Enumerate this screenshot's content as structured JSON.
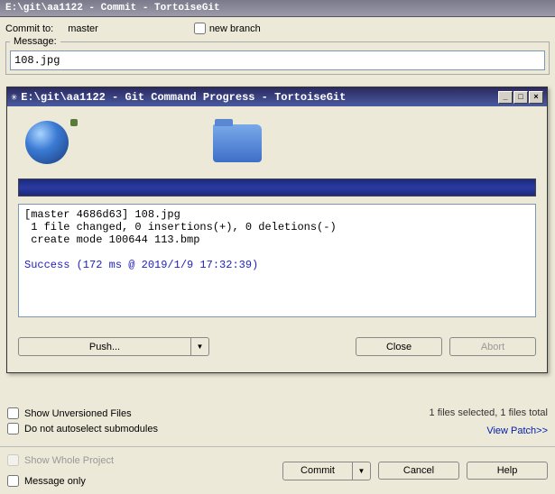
{
  "outer": {
    "title": "E:\\git\\aa1122 - Commit - TortoiseGit",
    "commit_to_label": "Commit to:",
    "commit_to_value": "master",
    "new_branch_label": "new branch",
    "message_legend": "Message:",
    "message_value": "108.jpg"
  },
  "dialog": {
    "title": "E:\\git\\aa1122 - Git Command Progress - TortoiseGit",
    "output_line1": "[master 4686d63] 108.jpg",
    "output_line2": " 1 file changed, 0 insertions(+), 0 deletions(-)",
    "output_line3": " create mode 100644 113.bmp",
    "output_success": "Success (172 ms @ 2019/1/9 17:32:39)",
    "push_label": "Push...",
    "close_label": "Close",
    "abort_label": "Abort"
  },
  "lower": {
    "show_unversioned": "Show Unversioned Files",
    "no_autoselect": "Do not autoselect submodules",
    "status": "1 files selected, 1 files total",
    "view_patch": "View Patch>>"
  },
  "footer": {
    "show_whole": "Show Whole Project",
    "message_only": "Message only",
    "commit": "Commit",
    "cancel": "Cancel",
    "help": "Help"
  }
}
